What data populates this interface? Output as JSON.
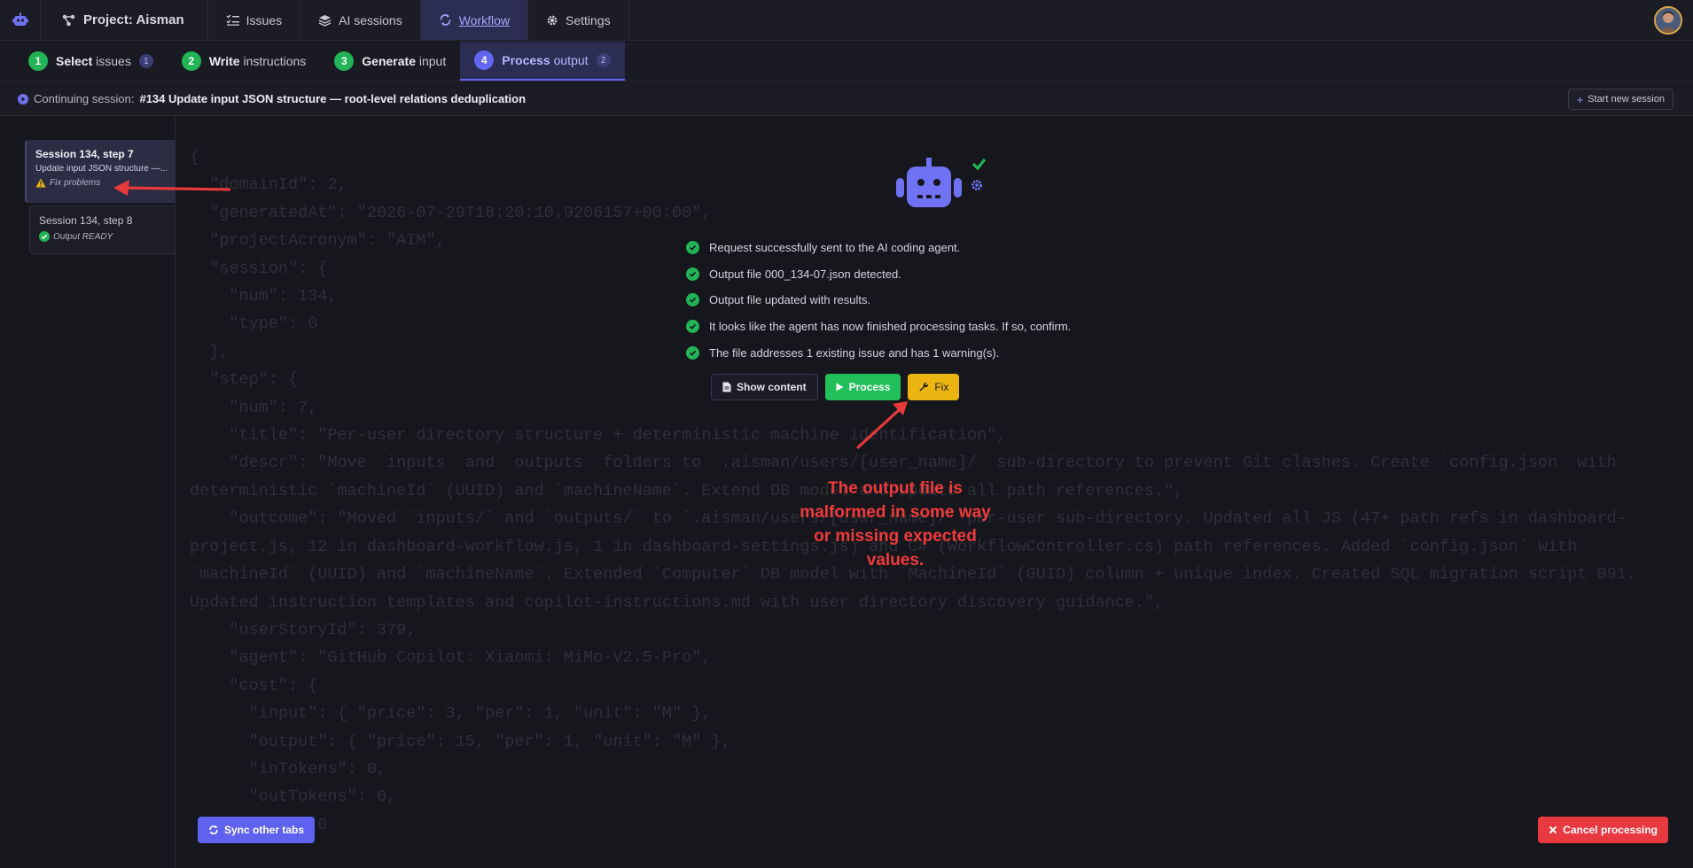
{
  "topnav": {
    "project": "Project: Aisman",
    "issues": "Issues",
    "ai_sessions": "AI sessions",
    "workflow": "Workflow",
    "settings": "Settings"
  },
  "steps": [
    {
      "num": "1",
      "bold": "Select",
      "rest": " issues",
      "count": "1"
    },
    {
      "num": "2",
      "bold": "Write",
      "rest": " instructions",
      "count": ""
    },
    {
      "num": "3",
      "bold": "Generate",
      "rest": " input",
      "count": ""
    },
    {
      "num": "4",
      "bold": "Process",
      "rest": " output",
      "count": "2"
    }
  ],
  "session_bar": {
    "label": "Continuing session:",
    "title": "#134 Update input JSON structure — root-level relations deduplication",
    "new_session": "Start new session"
  },
  "sidebar": {
    "cards": [
      {
        "title": "Session 134, step 7",
        "desc": "Update input JSON structure —...",
        "status": "Fix problems"
      },
      {
        "title": "Session 134, step 8",
        "status": "Output READY"
      }
    ]
  },
  "code_text": "{\n  \"domainId\": 2,\n  \"generatedAt\": \"2026-07-29T18:20:10.9206157+00:00\",\n  \"projectAcronym\": \"AIM\",\n  \"session\": {\n    \"num\": 134,\n    \"type\": 0\n  },\n  \"step\": {\n    \"num\": 7,\n    \"title\": \"Per-user directory structure + deterministic machine identification\",\n    \"descr\": \"Move `inputs` and `outputs` folders to `.aisman/users/[user_name]/` sub-directory to prevent Git clashes. Create `config.json` with deterministic `machineId` (UUID) and `machineName`. Extend DB model and update all path references.\",\n    \"outcome\": \"Moved `inputs/` and `outputs/` to `.aisman/users/[user_name]/` per-user sub-directory. Updated all JS (47+ path refs in dashboard-project.js, 12 in dashboard-workflow.js, 1 in dashboard-settings.js) and C# (WorkflowController.cs) path references. Added `config.json` with `machineId` (UUID) and `machineName`. Extended `Computer` DB model with `MachineId` (GUID) column + unique index. Created SQL migration script 091. Updated instruction templates and copilot-instructions.md with user directory discovery guidance.\",\n    \"userStoryId\": 379,\n    \"agent\": \"GitHub Copilot: Xiaomi: MiMo-V2.5-Pro\",\n    \"cost\": {\n      \"input\": { \"price\": 3, \"per\": 1, \"unit\": \"M\" },\n      \"output\": { \"price\": 15, \"per\": 1, \"unit\": \"M\" },\n      \"inTokens\": 0,\n      \"outTokens\": 0,\n      \"...\": 0",
  "status_lines": [
    "Request successfully sent to the AI coding agent.",
    "Output file 000_134-07.json detected.",
    "Output file updated with results.",
    "It looks like the agent has now finished processing tasks. If so, confirm.",
    "The file addresses 1 existing issue and has 1 warning(s)."
  ],
  "actions": {
    "show_content": "Show content",
    "process": "Process",
    "fix": "Fix"
  },
  "annotation": "The output file is malformed in some way or missing expected values.",
  "bottom": {
    "sync": "Sync other tabs",
    "cancel": "Cancel processing"
  },
  "colors": {
    "accent": "#6366f1",
    "success": "#22c05a",
    "warning": "#ebb410",
    "danger": "#e7393f",
    "annotation": "#ef3b3b"
  },
  "icons": [
    "app-logo-icon",
    "project-icon",
    "issues-icon",
    "ai-sessions-icon",
    "workflow-icon",
    "gear-icon",
    "play-circle-icon",
    "plus-icon",
    "warning-icon",
    "check-circle-icon",
    "robot-icon",
    "file-icon",
    "play-icon",
    "wrench-icon",
    "sync-icon",
    "close-icon"
  ]
}
